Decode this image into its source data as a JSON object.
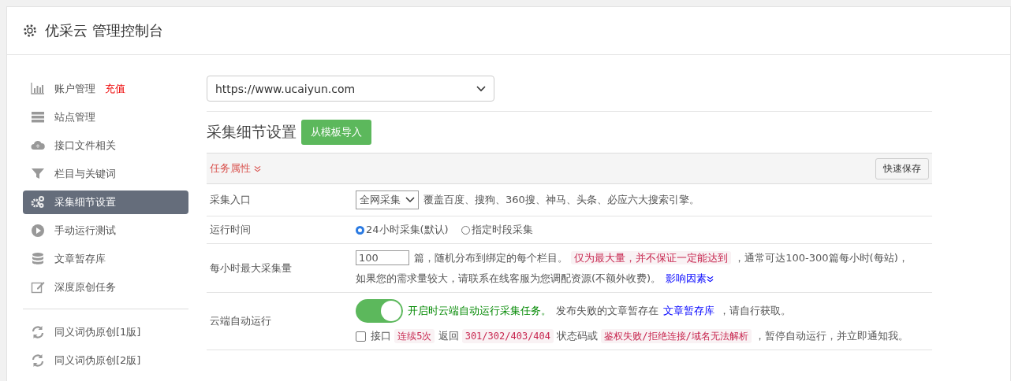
{
  "header": {
    "title": "优采云 管理控制台"
  },
  "sidebar": {
    "groups": [
      {
        "items": [
          {
            "label": "账户管理",
            "badge": "充值",
            "selected": false
          },
          {
            "label": "站点管理",
            "selected": false
          },
          {
            "label": "接口文件相关",
            "selected": false
          },
          {
            "label": "栏目与关键词",
            "selected": false
          },
          {
            "label": "采集细节设置",
            "selected": true
          },
          {
            "label": "手动运行测试",
            "selected": false
          },
          {
            "label": "文章暂存库",
            "selected": false
          },
          {
            "label": "深度原创任务",
            "selected": false
          }
        ]
      },
      {
        "items": [
          {
            "label": "同义词伪原创[1版]",
            "selected": false
          },
          {
            "label": "同义词伪原创[2版]",
            "selected": false
          }
        ]
      }
    ]
  },
  "site_select": {
    "value": "https://www.ucaiyun.com"
  },
  "section": {
    "title": "采集细节设置",
    "import_button": "从模板导入"
  },
  "panel": {
    "heading": "任务属性",
    "save_button": "快速保存"
  },
  "rows": [
    {
      "kind": "select",
      "label": "采集入口",
      "value": "全网采集",
      "note": "覆盖百度、搜狗、360搜、神马、头条、必应六大搜索引擎。"
    },
    {
      "kind": "radio",
      "label": "运行时间",
      "options": [
        {
          "label": "24小时采集(默认)",
          "selected": true
        },
        {
          "label": "指定时段采集",
          "selected": false
        }
      ]
    },
    {
      "kind": "number",
      "label": "每小时最大采集量",
      "value": "100",
      "sentence": "篇，随机分布到绑定的每个栏目。 **仅为最大量，并不保证一定能达到** ，通常可达100-300篇每小时(每站)，",
      "line2": "如果您的需求量较大，请联系在线客服为您调配资源(不额外收费)。",
      "link": "影响因素"
    },
    {
      "kind": "toggle",
      "label": "云端自动运行",
      "on": true,
      "note": "开启时云端自动运行采集任务。",
      "note2": "发布失败的文章暂存在",
      "link": "文章暂存库",
      "note3": "，请自行获取。",
      "check": {
        "checked": false,
        "parts": [
          {
            "kind": "text",
            "text": "接口"
          },
          {
            "kind": "code",
            "text": "连续5次"
          },
          {
            "kind": "text",
            "text": "返回"
          },
          {
            "kind": "code",
            "text": "301/302/403/404"
          },
          {
            "kind": "text",
            "text": "状态码或"
          },
          {
            "kind": "code",
            "text": "鉴权失败/拒绝连接/域名无法解析"
          },
          {
            "kind": "text",
            "text": "，暂停自动运行，并立即通知我。"
          }
        ]
      }
    }
  ]
}
